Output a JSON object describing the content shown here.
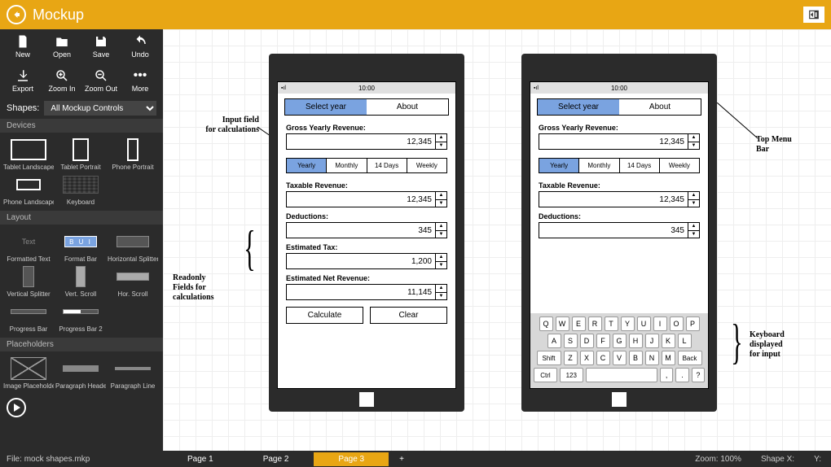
{
  "header": {
    "title": "Mockup"
  },
  "toolbar": {
    "row1": [
      {
        "label": "New",
        "name": "new-button"
      },
      {
        "label": "Open",
        "name": "open-button"
      },
      {
        "label": "Save",
        "name": "save-button"
      },
      {
        "label": "Undo",
        "name": "undo-button"
      }
    ],
    "row2": [
      {
        "label": "Export",
        "name": "export-button"
      },
      {
        "label": "Zoom In",
        "name": "zoom-in-button"
      },
      {
        "label": "Zoom Out",
        "name": "zoom-out-button"
      },
      {
        "label": "More",
        "name": "more-button"
      }
    ]
  },
  "shapes": {
    "label": "Shapes:",
    "selected": "All Mockup Controls"
  },
  "sections": {
    "devices": {
      "title": "Devices",
      "items": [
        "Tablet Landscape",
        "Tablet Portrait",
        "Phone Portrait",
        "Phone Landscape",
        "Keyboard"
      ]
    },
    "layout": {
      "title": "Layout",
      "items": [
        "Formatted Text",
        "Format Bar",
        "Horizontal Splitter",
        "Vertical Splitter",
        "Vert. Scroll",
        "Hor. Scroll",
        "Progress Bar",
        "Progress Bar 2"
      ]
    },
    "placeholders": {
      "title": "Placeholders",
      "items": [
        "Image Placeholder",
        "Paragraph Header",
        "Paragraph Line"
      ]
    }
  },
  "mock": {
    "time": "10:00",
    "tabs": {
      "select_year": "Select year",
      "about": "About"
    },
    "gross_label": "Gross Yearly Revenue:",
    "gross_value": "12,345",
    "periods": [
      "Yearly",
      "Monthly",
      "14 Days",
      "Weekly"
    ],
    "taxable_label": "Taxable Revenue:",
    "taxable_value": "12,345",
    "deductions_label": "Deductions:",
    "deductions_value": "345",
    "tax_label": "Estimated Tax:",
    "tax_value": "1,200",
    "net_label": "Estimated Net Revenue:",
    "net_value": "11,145",
    "calculate": "Calculate",
    "clear": "Clear"
  },
  "keyboard": {
    "row1": [
      "Q",
      "W",
      "E",
      "R",
      "T",
      "Y",
      "U",
      "I",
      "O",
      "P"
    ],
    "row2": [
      "A",
      "S",
      "D",
      "F",
      "G",
      "H",
      "J",
      "K",
      "L"
    ],
    "row3": [
      "Shift",
      "Z",
      "X",
      "C",
      "V",
      "B",
      "N",
      "M",
      "Back"
    ],
    "row4": [
      "Ctrl",
      "123",
      "",
      ",",
      ".",
      "?"
    ]
  },
  "annotations": {
    "input_field": "Input field\nfor calculations",
    "readonly": "Readonly\nFields for\ncalculations",
    "top_menu": "Top Menu\nBar",
    "keyboard": "Keyboard\ndisplayed\nfor input"
  },
  "status": {
    "file_label": "File:",
    "file_name": "mock shapes.mkp",
    "pages": [
      "Page 1",
      "Page 2",
      "Page 3"
    ],
    "active_page": 2,
    "zoom": "Zoom:  100%",
    "shapex": "Shape X:",
    "y": "Y:"
  }
}
